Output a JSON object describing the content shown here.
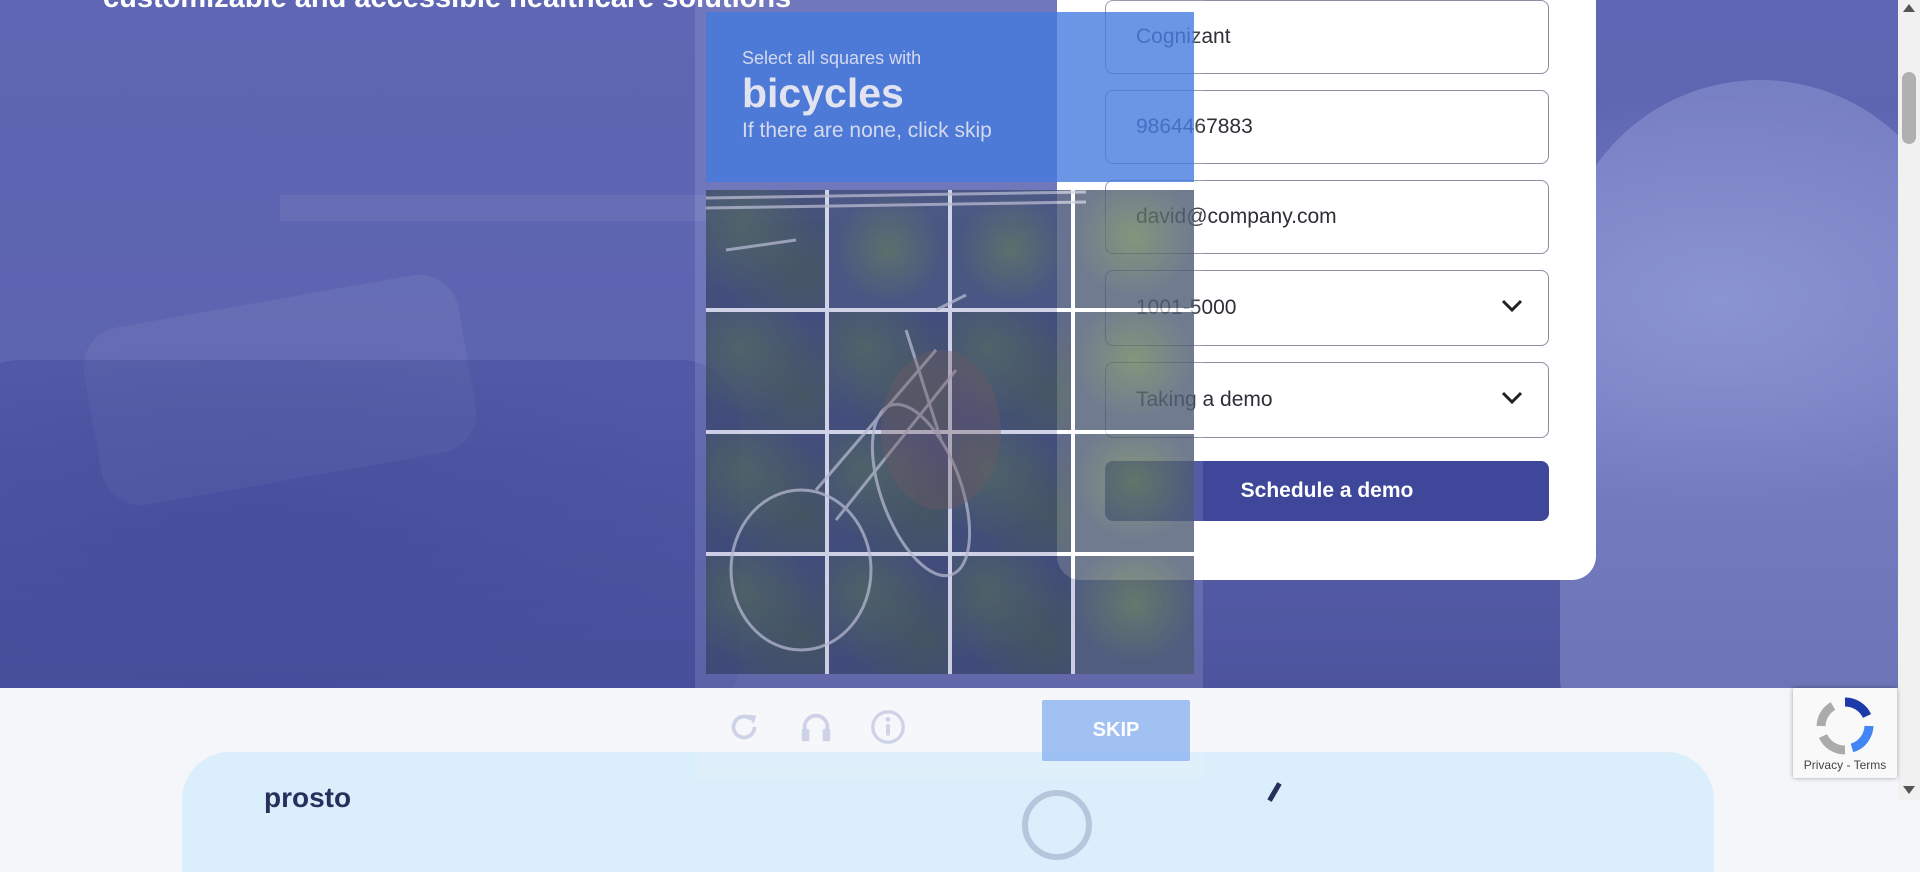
{
  "hero": {
    "title": "customizable and accessible healthcare solutions"
  },
  "form": {
    "company_value": "Cognizant",
    "phone_value": "9864467883",
    "email_value": "david@company.com",
    "company_size_value": "1001-5000",
    "interest_value": "Taking a demo",
    "submit_label": "Schedule a demo"
  },
  "challenge": {
    "prompt": "Select all squares with",
    "target": "bicycles",
    "subtext": "If there are none, click skip",
    "skip_label": "SKIP",
    "icons": [
      "refresh-icon",
      "audio-icon",
      "info-icon"
    ],
    "accent_color": "#4a7fe0"
  },
  "recaptcha": {
    "privacy_label": "Privacy",
    "separator": " - ",
    "terms_label": "Terms"
  },
  "lower_section": {
    "brand_text": "prosto"
  },
  "colors": {
    "hero_overlay": "#5f66b3",
    "button_bg": "#3f479a",
    "card_bg": "#ffffff"
  }
}
